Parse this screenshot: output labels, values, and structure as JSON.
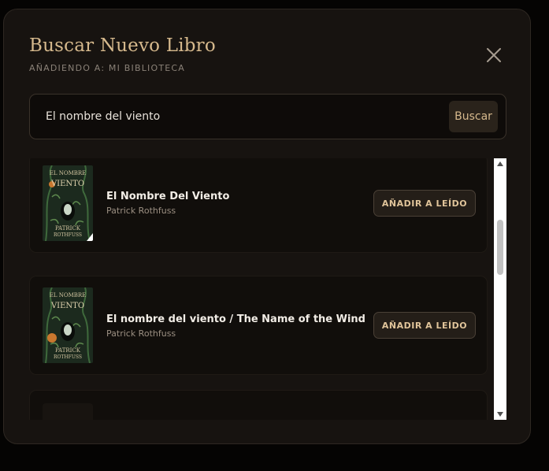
{
  "modal": {
    "title": "Buscar Nuevo Libro",
    "subtitle": "AÑADIENDO A: MI BIBLIOTECA",
    "close_icon": "close-icon"
  },
  "search": {
    "value": "El nombre del viento",
    "button_label": "Buscar"
  },
  "results": [
    {
      "title": "El Nombre Del Viento",
      "author": "Patrick Rothfuss",
      "button_label": "AÑADIR A LEÍDO",
      "cover_text": [
        "EL NOMBRE",
        "VIENTO",
        "PATRICK",
        "ROTHFUSS"
      ]
    },
    {
      "title": "El nombre del viento / The Name of the Wind",
      "author": "Patrick Rothfuss",
      "button_label": "AÑADIR A LEÍDO",
      "cover_text": [
        "EL NOMBRE",
        "VIENTO",
        "PATRICK",
        "ROTHFUSS"
      ]
    }
  ],
  "colors": {
    "accent": "#d6b98d",
    "background": "#171310",
    "card": "#110e0b"
  }
}
